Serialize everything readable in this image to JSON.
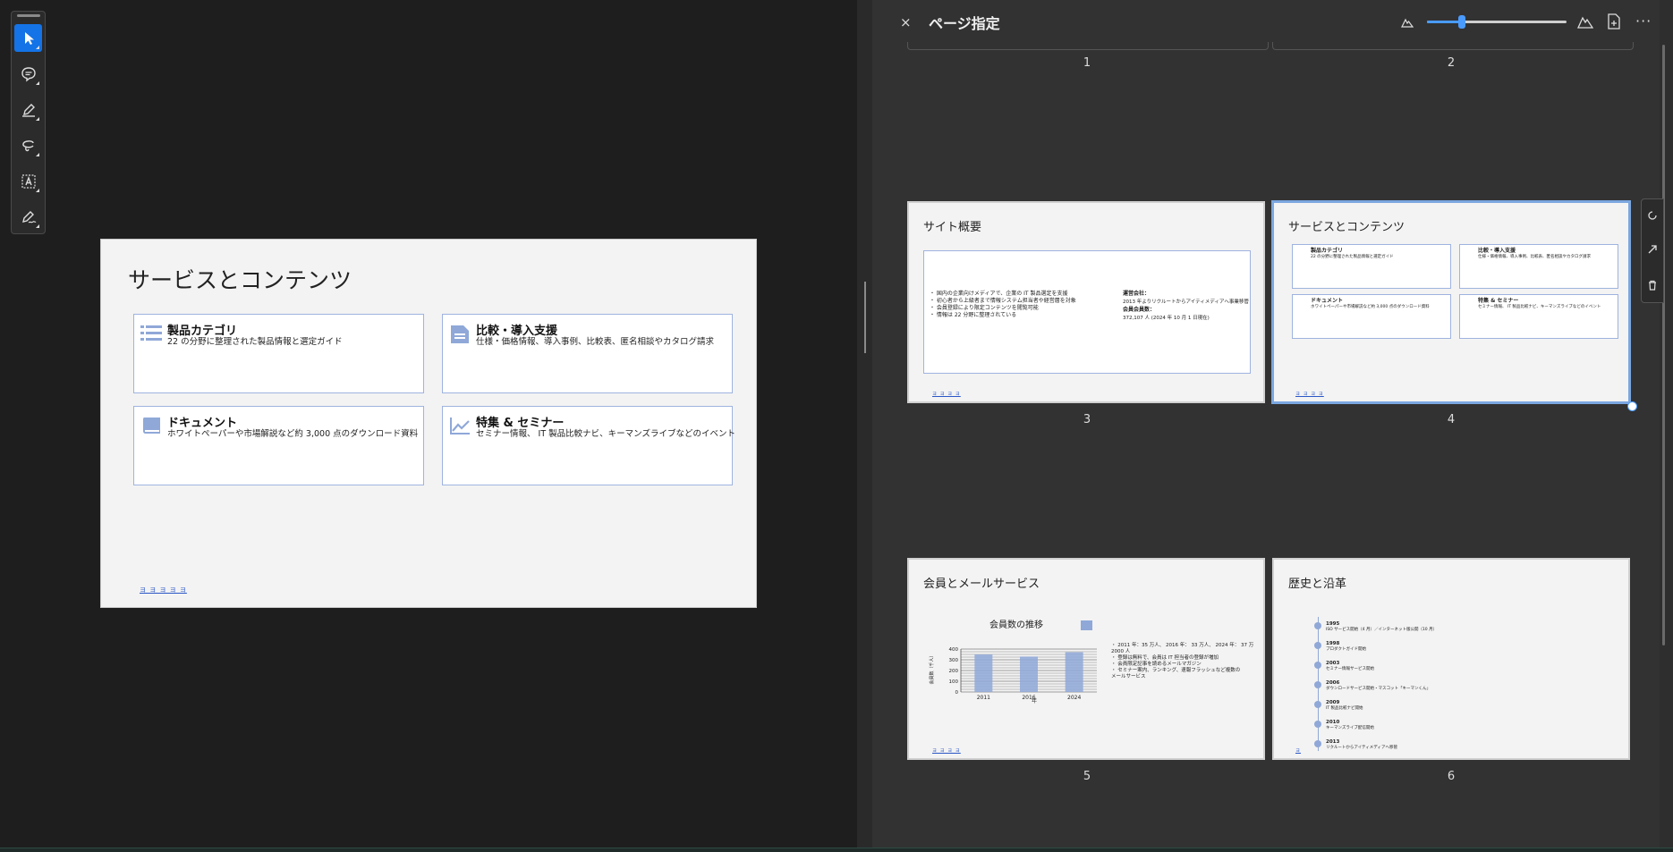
{
  "panel": {
    "close": "×",
    "title": "ページ指定",
    "more": "···",
    "zoom_level": 0.25
  },
  "slide": {
    "title": "サービスとコンテンツ",
    "cards": [
      {
        "title": "製品カテゴリ",
        "desc": "22 の分野に整理された製品情報と選定ガイド",
        "icon": "list-icon"
      },
      {
        "title": "比較・導入支援",
        "desc": "仕様・価格情報、導入事例、比較表、匿名相談やカタログ請求",
        "icon": "document-icon"
      },
      {
        "title": "ドキュメント",
        "desc": "ホワイトペーパーや市場解説など約 3,000 点のダウンロード資料",
        "icon": "book-icon"
      },
      {
        "title": "特集 & セミナー",
        "desc": "セミナー情報、 IT 製品比較ナビ、キーマンズライブなどのイベント",
        "icon": "chart-icon"
      }
    ],
    "footer": "ヨ ヨ ヨ ヨ ヨ"
  },
  "pages": [
    {
      "num": "1"
    },
    {
      "num": "2"
    },
    {
      "num": "3",
      "title": "サイト概要",
      "bullets": [
        "・ 国内の企業向けメディアで、企業の IT 製品選定を支援",
        "・ 初心者から上級者まで情報システム担当者や経営層を対象",
        "・ 会員登録により限定コンテンツを閲覧可能",
        "・ 情報は 22 分野に整理されている"
      ],
      "right_lines": [
        "運営会社：",
        "2013 年よりリクルートからアイティメディアへ事業移管",
        "会員会員数：",
        "372,107 人 (2024 年 10 月 1 日現在)"
      ],
      "footer": "ヨ ヨ ヨ ヨ"
    },
    {
      "num": "4",
      "title": "サービスとコンテンツ",
      "cards": [
        {
          "title": "製品カテゴリ",
          "desc": "22 の分野に整理された製品情報と選定ガイド"
        },
        {
          "title": "比較・導入支援",
          "desc": "仕様・価格情報、導入事例、比較表、匿名相談やカタログ請求"
        },
        {
          "title": "ドキュメント",
          "desc": "ホワイトペーパーや市場解説など約 3,000 点のダウンロード資料"
        },
        {
          "title": "特集 & セミナー",
          "desc": "セミナー情報、 IT 製品比較ナビ、キーマンズライブなどのイベント"
        }
      ],
      "footer": "ヨ ヨ ヨ ヨ"
    },
    {
      "num": "5",
      "title": "会員とメールサービス",
      "bullets": [
        "・ 2011 年：35 万人、 2016 年： 33 万人、 2024 年： 37 万",
        "  2000 人",
        "・ 登録は無料で、会員は IT 担当者の登録が増加",
        "・ 会員限定記事を読めるメールマガジン",
        "・ セミナー案内、ランキング、速報フラッシュなど複数の",
        "  メールサービス"
      ],
      "footer": "ヨ ヨ ヨ ヨ"
    },
    {
      "num": "6",
      "title": "歴史と沿革",
      "timeline": [
        {
          "year": "1995",
          "text": "ISO サービス開始（4 月）／インターネット版公開（10 月）"
        },
        {
          "year": "1998",
          "text": "プロダクトガイド開始"
        },
        {
          "year": "2003",
          "text": "セミナー情報サービス開始"
        },
        {
          "year": "2006",
          "text": "ダウンロードサービス開始・マスコット「キーマンくん」"
        },
        {
          "year": "2009",
          "text": "IT 製品比較ナビ開始"
        },
        {
          "year": "2010",
          "text": "キーマンズライブ配信開始"
        },
        {
          "year": "2013",
          "text": "リクルートからアイティメディアへ移管"
        }
      ],
      "footer": "ヨ"
    }
  ],
  "chart_data": {
    "type": "bar",
    "title": "会員数の推移",
    "categories": [
      "2011",
      "2016",
      "2024"
    ],
    "values": [
      350,
      330,
      370
    ],
    "ylim": [
      0,
      400
    ],
    "yticks": [
      "400",
      "300",
      "200",
      "100",
      "0"
    ],
    "xlabel": "年",
    "ylabel": "会員数（千人）",
    "bar_color": "#8fa8d8",
    "grid": true
  }
}
